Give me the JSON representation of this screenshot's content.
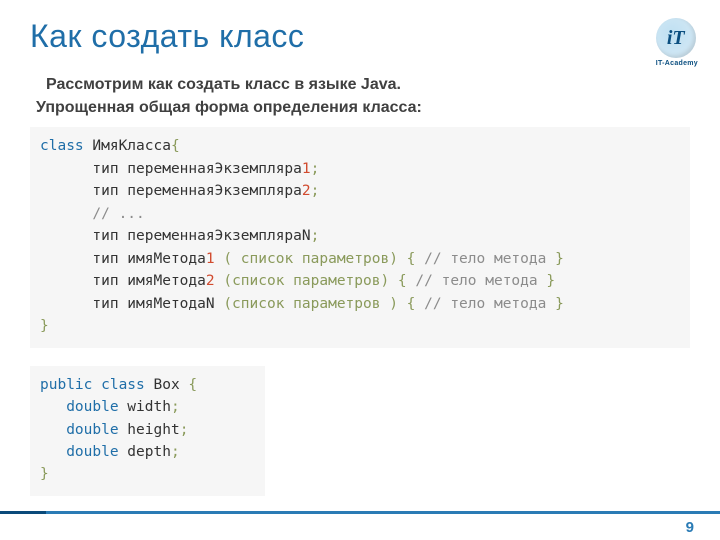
{
  "title": "Как создать класс",
  "logo": {
    "mark": "iT",
    "label": "IT-Academy"
  },
  "intro": {
    "line1": "Рассмотрим как создать класс в языке Java.",
    "line2": "Упрощенная общая форма определения класса:"
  },
  "code1": {
    "l1_kw": "class",
    "l1_name": " ИмяКласса",
    "l1_brace": "{",
    "l2_pre": "      тип переменнаяЭкземпляра",
    "l2_num": "1",
    "l2_semi": ";",
    "l3_pre": "      тип переменнаяЭкземпляра",
    "l3_num": "2",
    "l3_semi": ";",
    "l4_cmt": "      // ...",
    "l5_pre": "      тип переменнаяЭкземпляраN",
    "l5_semi": ";",
    "l6_pre": "      тип имяМетода",
    "l6_num": "1",
    "l6_mid": " ( список параметров) { ",
    "l6_cmt": "// тело метода ",
    "l6_end": "}",
    "l7_pre": "      тип имяМетода",
    "l7_num": "2",
    "l7_mid": " (список параметров) { ",
    "l7_cmt": "// тело метода ",
    "l7_end": "}",
    "l8_pre": "      тип имяМетодаN ",
    "l8_mid": "(список параметров ) { ",
    "l8_cmt": "// тело метода ",
    "l8_end": "}",
    "l9_close": "}"
  },
  "code2": {
    "l1_a": "public class",
    "l1_b": " Box ",
    "l1_c": "{",
    "l2_a": "   double",
    "l2_b": " width",
    "l2_c": ";",
    "l3_a": "   double",
    "l3_b": " height",
    "l3_c": ";",
    "l4_a": "   double",
    "l4_b": " depth",
    "l4_c": ";",
    "l5": "}"
  },
  "page_number": "9"
}
